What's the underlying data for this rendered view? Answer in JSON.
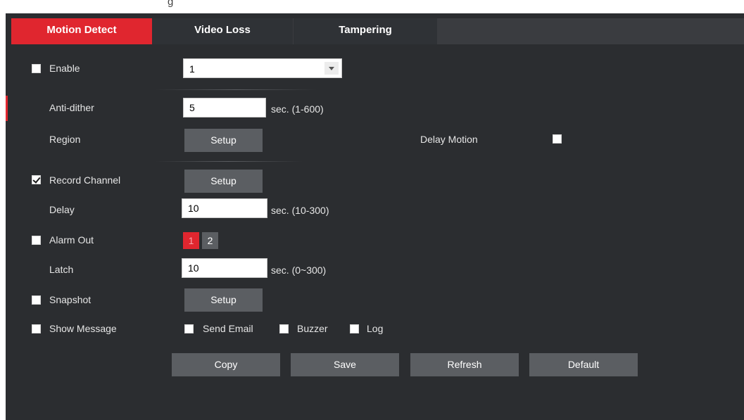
{
  "top_fragment": "g",
  "tabs": [
    {
      "label": "Motion Detect",
      "active": true
    },
    {
      "label": "Video Loss",
      "active": false
    },
    {
      "label": "Tampering",
      "active": false
    }
  ],
  "enable": {
    "label": "Enable",
    "checked": false,
    "channel_value": "1"
  },
  "anti_dither": {
    "label": "Anti-dither",
    "value": "5",
    "unit": "sec. (1-600)"
  },
  "region": {
    "label": "Region",
    "button": "Setup"
  },
  "delay_motion": {
    "label": "Delay Motion",
    "checked": false
  },
  "record_channel": {
    "label": "Record Channel",
    "checked": true,
    "button": "Setup"
  },
  "delay": {
    "label": "Delay",
    "value": "10",
    "unit": "sec. (10-300)"
  },
  "alarm_out": {
    "label": "Alarm Out",
    "checked": false,
    "channels": [
      "1",
      "2"
    ]
  },
  "latch": {
    "label": "Latch",
    "value": "10",
    "unit": "sec. (0~300)"
  },
  "snapshot": {
    "label": "Snapshot",
    "checked": false,
    "button": "Setup"
  },
  "show_message": {
    "label": "Show Message",
    "checked": false
  },
  "send_email": {
    "label": "Send Email",
    "checked": false
  },
  "buzzer": {
    "label": "Buzzer",
    "checked": false
  },
  "log": {
    "label": "Log",
    "checked": false
  },
  "actions": {
    "copy": "Copy",
    "save": "Save",
    "refresh": "Refresh",
    "default": "Default"
  },
  "colors": {
    "accent": "#e0262f",
    "panel": "#2b2d30",
    "button": "#5b5e62"
  }
}
